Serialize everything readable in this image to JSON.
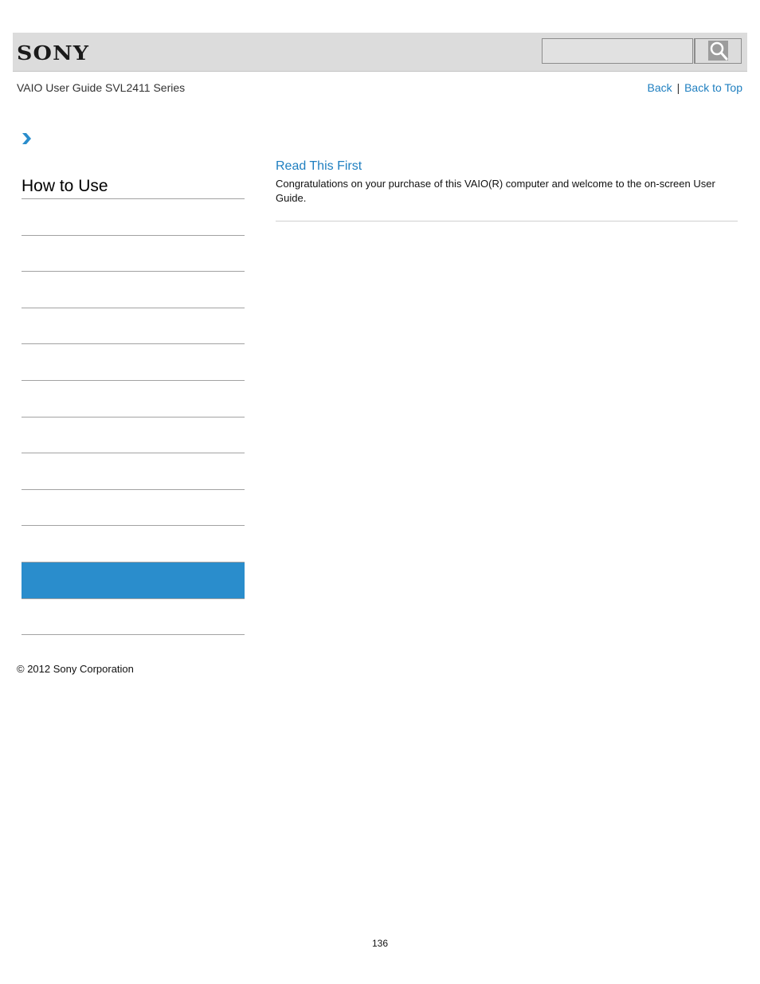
{
  "header": {
    "logo": "SONY",
    "search": {
      "value": "",
      "placeholder": ""
    },
    "search_button_icon": "magnifier-icon"
  },
  "subheader": {
    "guide_title": "VAIO User Guide SVL2411 Series",
    "links": {
      "back": "Back",
      "separator": "|",
      "back_to_top": "Back to Top"
    }
  },
  "breadcrumb": {
    "icon": "chevron-right-icon"
  },
  "sidebar": {
    "title": "How to Use",
    "items": [
      {
        "label": "",
        "active": false
      },
      {
        "label": "",
        "active": false
      },
      {
        "label": "",
        "active": false
      },
      {
        "label": "",
        "active": false
      },
      {
        "label": "",
        "active": false
      },
      {
        "label": "",
        "active": false
      },
      {
        "label": "",
        "active": false
      },
      {
        "label": "",
        "active": false
      },
      {
        "label": "",
        "active": false
      },
      {
        "label": "",
        "active": false
      },
      {
        "label": "",
        "active": true
      },
      {
        "label": "",
        "active": false
      }
    ],
    "active_color": "#2a8dcc"
  },
  "main": {
    "entries": [
      {
        "title": "Read This First",
        "description": "Congratulations on your purchase of this VAIO(R) computer and welcome to the on-screen User Guide."
      }
    ]
  },
  "footer": {
    "copyright": "© 2012 Sony Corporation",
    "page_number": "136"
  },
  "colors": {
    "link": "#1f7fc0",
    "header_bg": "#dcdcdc",
    "accent": "#2a8dcc"
  }
}
